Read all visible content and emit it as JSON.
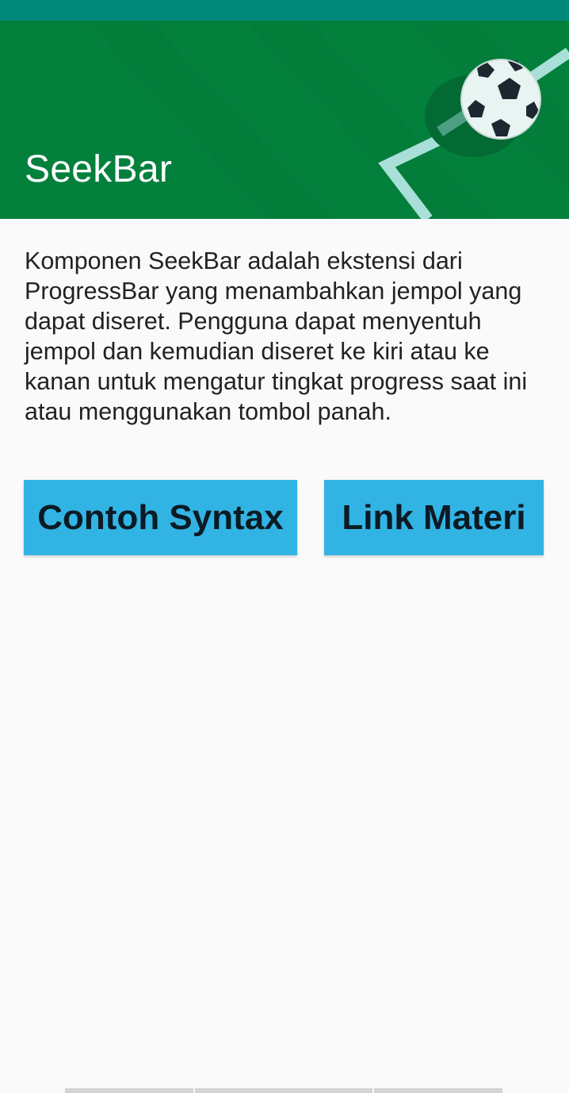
{
  "status_bar": {
    "color": "#00897b"
  },
  "header": {
    "title": "SeekBar",
    "background_color": "#03803c",
    "illustration": "soccer-ball-icon"
  },
  "content": {
    "description": "Komponen SeekBar adalah ekstensi dari ProgressBar yang menambahkan jempol yang dapat diseret. Pengguna dapat menyentuh jempol dan kemudian diseret ke kiri atau ke kanan untuk mengatur tingkat progress saat ini atau menggunakan tombol panah."
  },
  "buttons": {
    "syntax_label": "Contoh Syntax",
    "link_label": "Link Materi",
    "color": "#31b4e4"
  }
}
